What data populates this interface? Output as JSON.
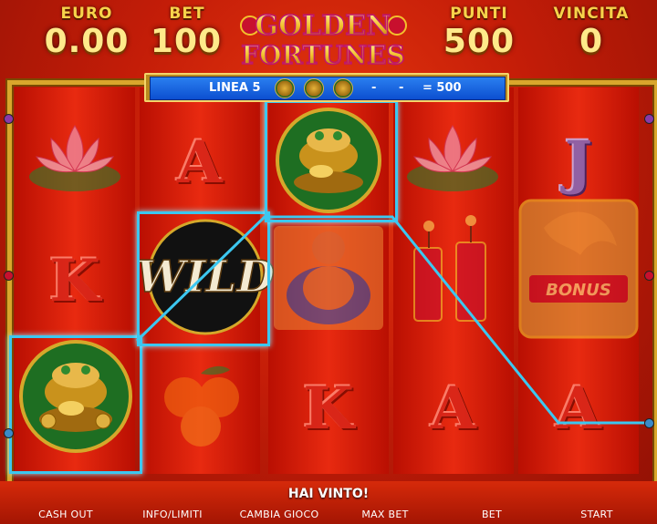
{
  "header": {
    "euro_label": "EURO",
    "euro_value": "0.00",
    "bet_label": "BET",
    "bet_value": "100",
    "punti_label": "PUNTI",
    "punti_value": "500",
    "vincita_label": "VINCITA",
    "vincita_value": "0",
    "logo_line1": "GOLDEN",
    "logo_line2": "FORTUNES"
  },
  "payline": {
    "line_label": "LINEA 5",
    "dash1": "-",
    "dash2": "-",
    "result": "= 500"
  },
  "reels": {
    "bonus_text": "BONUS",
    "wild_text": "WILD",
    "k1": "K",
    "a1": "A",
    "j1": "J",
    "k2": "K",
    "a2": "A",
    "a3": "A"
  },
  "status": {
    "message": "HAI VINTO!"
  },
  "buttons": {
    "cash_out": "CASH OUT",
    "info": "INFO/LIMITI",
    "cambia": "CAMBIA GIOCO",
    "max_bet": "MAX BET",
    "bet": "BET",
    "start": "START"
  },
  "colors": {
    "accent_gold": "#f7d34a",
    "payline": "#3cc7f0",
    "banner_blue": "#1a66e0"
  }
}
